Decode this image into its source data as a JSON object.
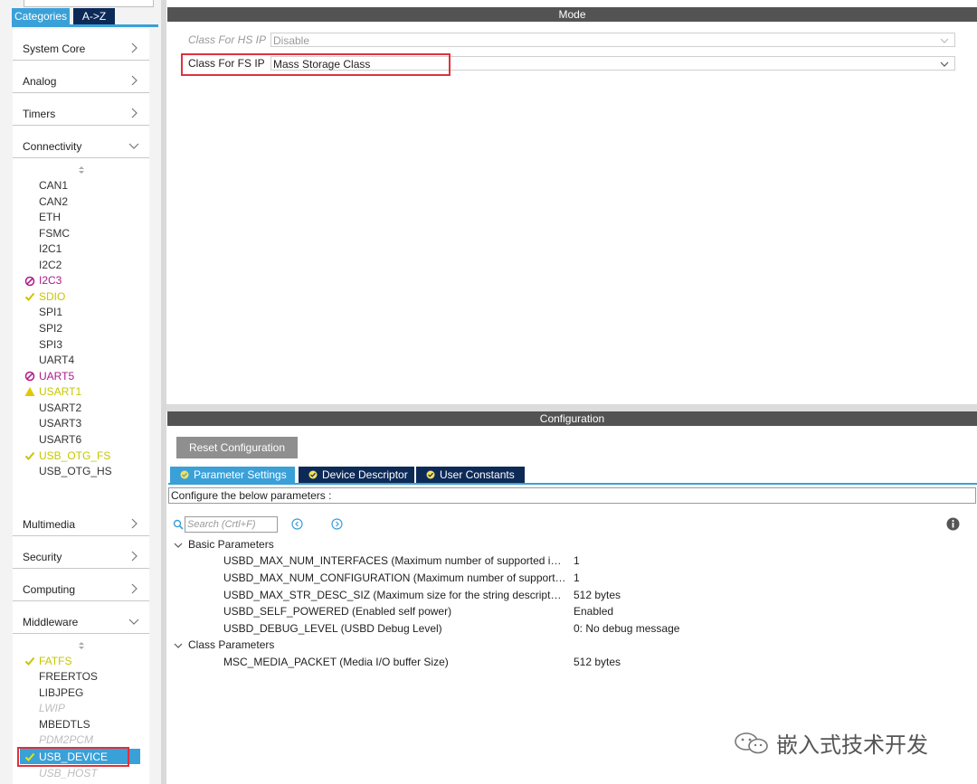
{
  "sidebar": {
    "tabs": [
      "Categories",
      "A->Z"
    ],
    "categories": [
      {
        "label": "System Core",
        "state": "collapsed"
      },
      {
        "label": "Analog",
        "state": "collapsed"
      },
      {
        "label": "Timers",
        "state": "collapsed"
      },
      {
        "label": "Connectivity",
        "state": "expanded"
      },
      {
        "label": "Multimedia",
        "state": "collapsed"
      },
      {
        "label": "Security",
        "state": "collapsed"
      },
      {
        "label": "Computing",
        "state": "collapsed"
      },
      {
        "label": "Middleware",
        "state": "expanded"
      }
    ],
    "connectivity_items": [
      {
        "label": "CAN1",
        "status": "none"
      },
      {
        "label": "CAN2",
        "status": "none"
      },
      {
        "label": "ETH",
        "status": "none"
      },
      {
        "label": "FSMC",
        "status": "none"
      },
      {
        "label": "I2C1",
        "status": "none"
      },
      {
        "label": "I2C2",
        "status": "none"
      },
      {
        "label": "I2C3",
        "status": "conflict"
      },
      {
        "label": "SDIO",
        "status": "ok"
      },
      {
        "label": "SPI1",
        "status": "none"
      },
      {
        "label": "SPI2",
        "status": "none"
      },
      {
        "label": "SPI3",
        "status": "none"
      },
      {
        "label": "UART4",
        "status": "none"
      },
      {
        "label": "UART5",
        "status": "conflict"
      },
      {
        "label": "USART1",
        "status": "warning"
      },
      {
        "label": "USART2",
        "status": "none"
      },
      {
        "label": "USART3",
        "status": "none"
      },
      {
        "label": "USART6",
        "status": "none"
      },
      {
        "label": "USB_OTG_FS",
        "status": "ok"
      },
      {
        "label": "USB_OTG_HS",
        "status": "none"
      }
    ],
    "middleware_items": [
      {
        "label": "FATFS",
        "status": "ok"
      },
      {
        "label": "FREERTOS",
        "status": "none"
      },
      {
        "label": "LIBJPEG",
        "status": "none"
      },
      {
        "label": "LWIP",
        "status": "disabled"
      },
      {
        "label": "MBEDTLS",
        "status": "none"
      },
      {
        "label": "PDM2PCM",
        "status": "disabled"
      },
      {
        "label": "USB_DEVICE",
        "status": "ok-selected"
      },
      {
        "label": "USB_HOST",
        "status": "disabled"
      }
    ]
  },
  "mode": {
    "header": "Mode",
    "hs_label": "Class For HS IP",
    "hs_value": "Disable",
    "fs_label": "Class For FS IP",
    "fs_value": "Mass Storage Class"
  },
  "configuration": {
    "header": "Configuration",
    "reset_label": "Reset Configuration",
    "tabs": [
      "Parameter Settings",
      "Device Descriptor",
      "User Constants"
    ],
    "configure_text": "Configure the below parameters :",
    "search_placeholder": "Search (Crtl+F)",
    "groups": [
      {
        "label": "Basic Parameters",
        "params": [
          {
            "name": "USBD_MAX_NUM_INTERFACES (Maximum number of supported int...",
            "value": "1"
          },
          {
            "name": "USBD_MAX_NUM_CONFIGURATION (Maximum number of supporte...",
            "value": "1"
          },
          {
            "name": "USBD_MAX_STR_DESC_SIZ (Maximum size for the string descriptors)",
            "value": "512 bytes"
          },
          {
            "name": "USBD_SELF_POWERED (Enabled self power)",
            "value": "Enabled"
          },
          {
            "name": "USBD_DEBUG_LEVEL (USBD Debug Level)",
            "value": "0: No debug message"
          }
        ]
      },
      {
        "label": "Class Parameters",
        "params": [
          {
            "name": "MSC_MEDIA_PACKET (Media I/O buffer Size)",
            "value": "512 bytes"
          }
        ]
      }
    ]
  },
  "watermark": "嵌入式技术开发",
  "colors": {
    "accent": "#3aa0d8",
    "navy": "#0d2a57",
    "header": "#535353",
    "ok": "#c6c600",
    "conflict": "#b0178a",
    "highlight": "#e0313a"
  }
}
